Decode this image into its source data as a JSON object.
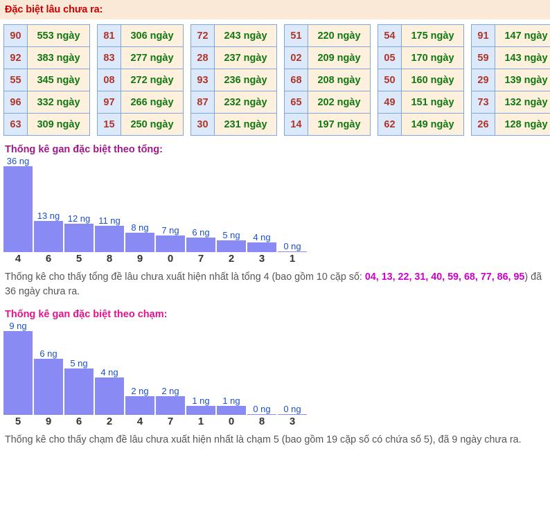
{
  "header": {
    "title": "Đặc biệt lâu chưa ra:"
  },
  "gan_table": {
    "columns": [
      [
        {
          "num": "90",
          "days": "553 ngày"
        },
        {
          "num": "92",
          "days": "383 ngày"
        },
        {
          "num": "55",
          "days": "345 ngày"
        },
        {
          "num": "96",
          "days": "332 ngày"
        },
        {
          "num": "63",
          "days": "309 ngày"
        }
      ],
      [
        {
          "num": "81",
          "days": "306 ngày"
        },
        {
          "num": "83",
          "days": "277 ngày"
        },
        {
          "num": "08",
          "days": "272 ngày"
        },
        {
          "num": "97",
          "days": "266 ngày"
        },
        {
          "num": "15",
          "days": "250 ngày"
        }
      ],
      [
        {
          "num": "72",
          "days": "243 ngày"
        },
        {
          "num": "28",
          "days": "237 ngày"
        },
        {
          "num": "93",
          "days": "236 ngày"
        },
        {
          "num": "87",
          "days": "232 ngày"
        },
        {
          "num": "30",
          "days": "231 ngày"
        }
      ],
      [
        {
          "num": "51",
          "days": "220 ngày"
        },
        {
          "num": "02",
          "days": "209 ngày"
        },
        {
          "num": "68",
          "days": "208 ngày"
        },
        {
          "num": "65",
          "days": "202 ngày"
        },
        {
          "num": "14",
          "days": "197 ngày"
        }
      ],
      [
        {
          "num": "54",
          "days": "175 ngày"
        },
        {
          "num": "05",
          "days": "170 ngày"
        },
        {
          "num": "50",
          "days": "160 ngày"
        },
        {
          "num": "49",
          "days": "151 ngày"
        },
        {
          "num": "62",
          "days": "149 ngày"
        }
      ],
      [
        {
          "num": "91",
          "days": "147 ngày"
        },
        {
          "num": "59",
          "days": "143 ngày"
        },
        {
          "num": "29",
          "days": "139 ngày"
        },
        {
          "num": "73",
          "days": "132 ngày"
        },
        {
          "num": "26",
          "days": "128 ngày"
        }
      ]
    ]
  },
  "section_tong": {
    "heading": "Thống kê gan đặc biệt theo tổng:",
    "paragraph_pre": "Thống kê cho thấy tổng đề lâu chưa xuất hiện nhất là tổng 4 (bao gồm 10 cặp số: ",
    "paragraph_numbers": "04, 13, 22, 31, 40, 59, 68, 77, 86, 95",
    "paragraph_post": ") đã 36 ngày chưa ra."
  },
  "section_cham": {
    "heading": "Thống kê gan đặc biệt theo chạm:",
    "paragraph": "Thống kê cho thấy chạm đề lâu chưa xuất hiện nhất là chạm 5 (bao gồm 19 cặp số có chứa số 5), đã 9 ngày chưa ra."
  },
  "chart_data": [
    {
      "type": "bar",
      "title": "Thống kê gan đặc biệt theo tổng:",
      "xlabel": "",
      "ylabel": "ngày (ng)",
      "categories": [
        "4",
        "6",
        "5",
        "8",
        "9",
        "0",
        "7",
        "2",
        "3",
        "1"
      ],
      "values": [
        36,
        13,
        12,
        11,
        8,
        7,
        6,
        5,
        4,
        0
      ],
      "data_labels": [
        "36 ng",
        "13 ng",
        "12 ng",
        "11 ng",
        "8 ng",
        "7 ng",
        "6 ng",
        "5 ng",
        "4 ng",
        "0 ng"
      ],
      "ylim": [
        0,
        36
      ],
      "grid": false,
      "legend": false,
      "bar_color": "#8a8af5",
      "label_color": "#1a4fd0"
    },
    {
      "type": "bar",
      "title": "Thống kê gan đặc biệt theo chạm:",
      "xlabel": "",
      "ylabel": "ngày (ng)",
      "categories": [
        "5",
        "9",
        "6",
        "2",
        "4",
        "7",
        "1",
        "0",
        "8",
        "3"
      ],
      "values": [
        9,
        6,
        5,
        4,
        2,
        2,
        1,
        1,
        0,
        0
      ],
      "data_labels": [
        "9 ng",
        "6 ng",
        "5 ng",
        "4 ng",
        "2 ng",
        "2 ng",
        "1 ng",
        "1 ng",
        "0 ng",
        "0 ng"
      ],
      "ylim": [
        0,
        9
      ],
      "grid": false,
      "legend": false,
      "bar_color": "#8a8af5",
      "label_color": "#1a4fd0"
    }
  ],
  "colors": {
    "header_band": "#fbe9d7",
    "header_text": "#cc0000",
    "cell_num_bg": "#dbe9fa",
    "cell_num_text": "#b03428",
    "cell_days_bg": "#fdf0dc",
    "cell_days_text": "#117711",
    "cell_border": "#7da7e0",
    "heading_tong": "#9c1a86",
    "heading_cham": "#e4138e",
    "bar": "#8a8af5",
    "bar_label": "#1a4fd0",
    "paragraph_text": "#555555",
    "paragraph_highlight": "#cc00cc"
  }
}
